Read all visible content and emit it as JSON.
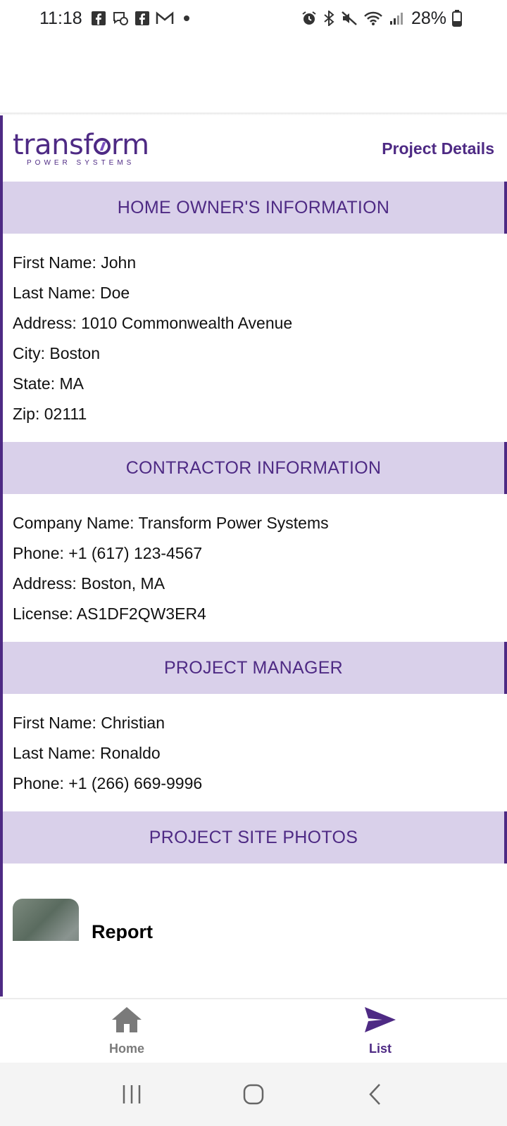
{
  "status_bar": {
    "time": "11:18",
    "battery": "28%",
    "left_icons": [
      "facebook-icon",
      "messenger-icon",
      "facebook-icon",
      "gmail-icon",
      "dot-icon"
    ],
    "right_icons": [
      "alarm-icon",
      "bluetooth-icon",
      "mute-icon",
      "wifi-icon",
      "signal-icon",
      "battery-icon"
    ]
  },
  "header": {
    "logo_text_1": "transf",
    "logo_text_2": "rm",
    "logo_sub": "POWER SYSTEMS",
    "title": "Project Details"
  },
  "sections": {
    "home_owner": {
      "title": "HOME OWNER'S INFORMATION",
      "fields": [
        "First Name: John",
        "Last Name: Doe",
        "Address: 1010 Commonwealth Avenue",
        "City: Boston",
        "State: MA",
        "Zip: 02111"
      ]
    },
    "contractor": {
      "title": "CONTRACTOR INFORMATION",
      "fields": [
        "Company Name: Transform Power Systems",
        "Phone: +1 (617) 123-4567",
        "Address: Boston, MA",
        "License: AS1DF2QW3ER4"
      ]
    },
    "project_manager": {
      "title": "PROJECT MANAGER",
      "fields": [
        "First Name: Christian",
        "Last Name: Ronaldo",
        "Phone: +1 (266) 669-9996"
      ]
    },
    "site_photos": {
      "title": "PROJECT SITE PHOTOS",
      "items": [
        {
          "label": "Report"
        }
      ]
    }
  },
  "bottom_nav": {
    "home_label": "Home",
    "list_label": "List"
  },
  "colors": {
    "brand": "#4e2a84",
    "section_bg": "#d9d0ea"
  }
}
